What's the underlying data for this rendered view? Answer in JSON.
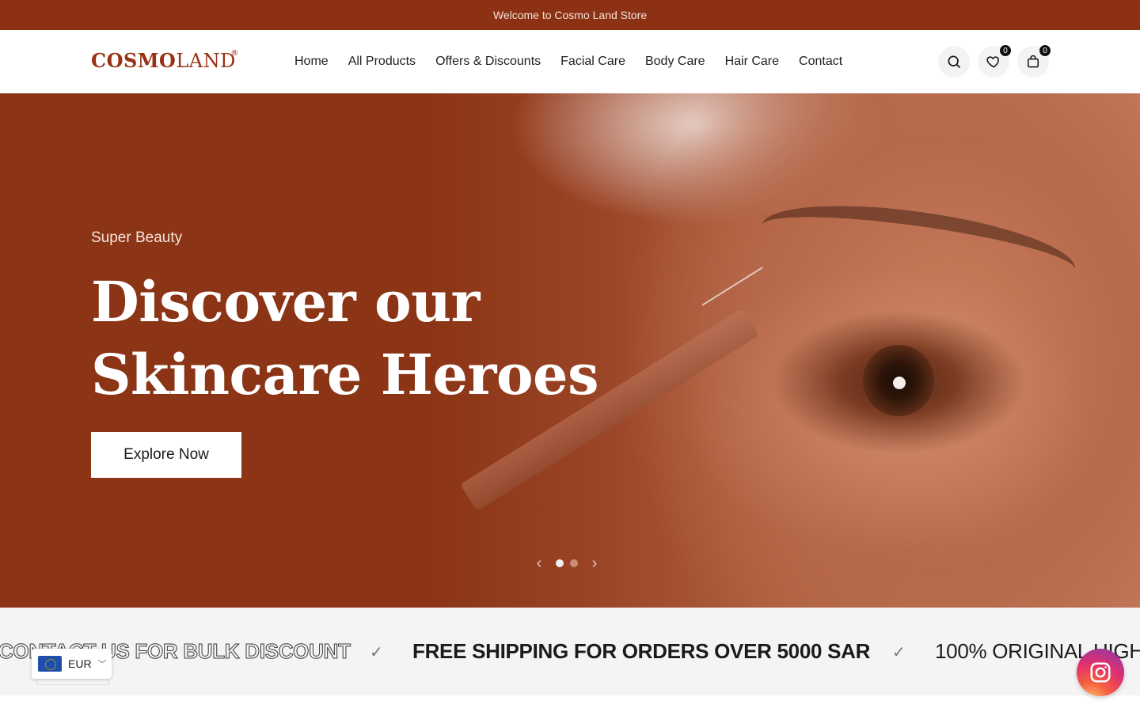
{
  "announcement": {
    "text": "Welcome to Cosmo Land Store"
  },
  "header": {
    "logo": {
      "part1": "COSMO",
      "part2": "LAND",
      "mark": "®"
    },
    "nav": [
      "Home",
      "All Products",
      "Offers & Discounts",
      "Facial Care",
      "Body Care",
      "Hair Care",
      "Contact"
    ],
    "icons": {
      "search": "search-icon",
      "wishlist": "heart-icon",
      "cart": "bag-icon"
    },
    "wishlist_count": "0",
    "cart_count": "0"
  },
  "hero": {
    "subtitle": "Super Beauty",
    "title_line1": "Discover our",
    "title_line2": "Skincare Heroes",
    "cta": "Explore Now",
    "slides": 2,
    "active_slide": 1,
    "prev_icon": "‹",
    "next_icon": "›"
  },
  "marquee": {
    "items": [
      "CONTACT US FOR BULK DISCOUNT",
      "FREE SHIPPING FOR ORDERS OVER 5000 SAR",
      "100% ORIGINAL HIGH"
    ],
    "separator": "✓"
  },
  "currency": {
    "code": "EUR",
    "chevron": "﹀"
  },
  "colors": {
    "brand": "#8c3114",
    "hero_bg": "#8b3416",
    "strip_bg": "#f4f4f4"
  }
}
